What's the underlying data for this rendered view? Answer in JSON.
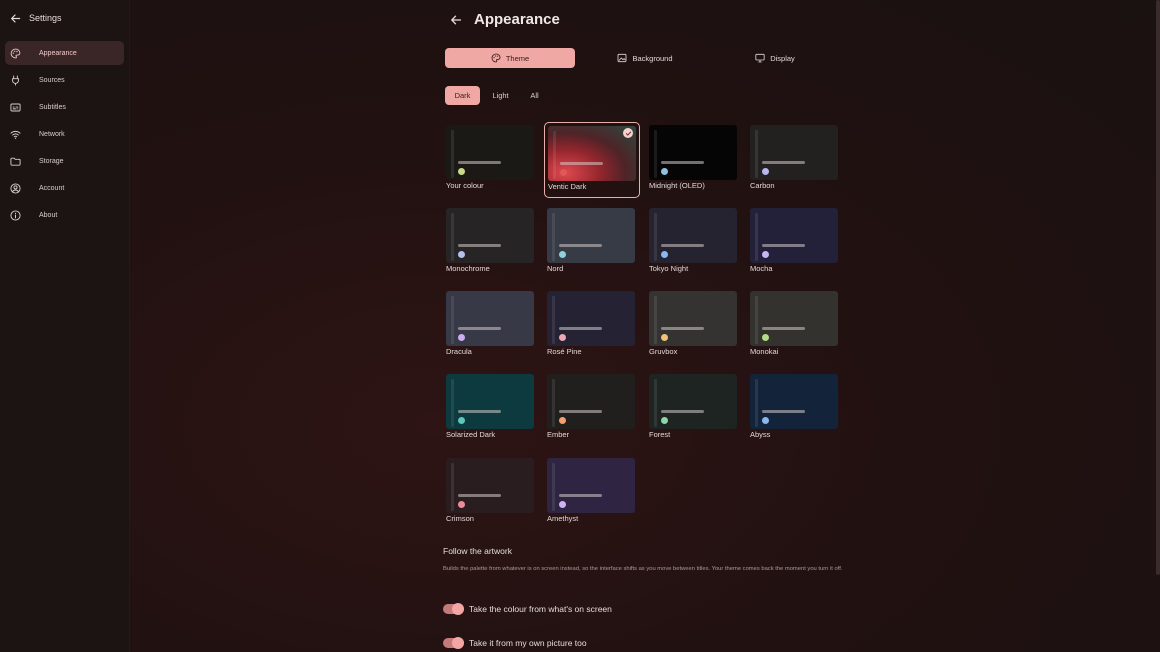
{
  "sidebar": {
    "title": "Settings",
    "items": [
      {
        "label": "Appearance",
        "icon": "palette-icon",
        "active": true
      },
      {
        "label": "Sources",
        "icon": "plug-icon"
      },
      {
        "label": "Subtitles",
        "icon": "subtitles-icon"
      },
      {
        "label": "Network",
        "icon": "wifi-icon"
      },
      {
        "label": "Storage",
        "icon": "folder-icon"
      },
      {
        "label": "Account",
        "icon": "account-icon"
      },
      {
        "label": "About",
        "icon": "info-icon"
      }
    ]
  },
  "header": {
    "title": "Appearance"
  },
  "tabs": [
    {
      "label": "Theme",
      "icon": "palette-icon",
      "active": true
    },
    {
      "label": "Background",
      "icon": "image-icon"
    },
    {
      "label": "Display",
      "icon": "monitor-icon"
    }
  ],
  "filters": [
    {
      "label": "Dark",
      "active": true
    },
    {
      "label": "Light"
    },
    {
      "label": "All"
    }
  ],
  "themes": [
    {
      "label": "Your colour",
      "bg": "#1a1915",
      "dot": "#c9d98a"
    },
    {
      "label": "Ventic Dark",
      "bg": "#7a2c30",
      "dot": "#e05858",
      "selected": true
    },
    {
      "label": "Midnight (OLED)",
      "bg": "#050505",
      "dot": "#8cc2e0"
    },
    {
      "label": "Carbon",
      "bg": "#232020",
      "dot": "#b8b6ea"
    },
    {
      "label": "Monochrome",
      "bg": "#262424",
      "dot": "#b6c0f0"
    },
    {
      "label": "Nord",
      "bg": "#363b45",
      "dot": "#8fd0dc"
    },
    {
      "label": "Tokyo Night",
      "bg": "#24232f",
      "dot": "#8ab8f2"
    },
    {
      "label": "Mocha",
      "bg": "#23213a",
      "dot": "#c8b6f2"
    },
    {
      "label": "Dracula",
      "bg": "#383947",
      "dot": "#c8aef2"
    },
    {
      "label": "Rosé Pine",
      "bg": "#252234",
      "dot": "#eea6b6"
    },
    {
      "label": "Gruvbox",
      "bg": "#353332",
      "dot": "#f0c470"
    },
    {
      "label": "Monokai",
      "bg": "#33322e",
      "dot": "#b6dc86"
    },
    {
      "label": "Solarized Dark",
      "bg": "#0d3a3f",
      "dot": "#5cc6bc"
    },
    {
      "label": "Ember",
      "bg": "#211f1d",
      "dot": "#f2a070"
    },
    {
      "label": "Forest",
      "bg": "#1d2421",
      "dot": "#8cd6a8"
    },
    {
      "label": "Abyss",
      "bg": "#13243a",
      "dot": "#8ab6f0"
    },
    {
      "label": "Crimson",
      "bg": "#2a1d1f",
      "dot": "#f08a9a"
    },
    {
      "label": "Amethyst",
      "bg": "#2f2543",
      "dot": "#cfb2f2"
    }
  ],
  "follow": {
    "title": "Follow the artwork",
    "description": "Builds the palette from whatever is on screen instead, so the interface shifts as you move between titles. Your theme comes back the moment you turn it off.",
    "toggles": [
      {
        "label": "Take the colour from what's on screen",
        "on": true
      },
      {
        "label": "Take it from my own picture too",
        "on": true
      }
    ]
  },
  "colors": {
    "accent": "#f0a8a5",
    "active_nav": "#3b2627",
    "background": "#221111"
  }
}
